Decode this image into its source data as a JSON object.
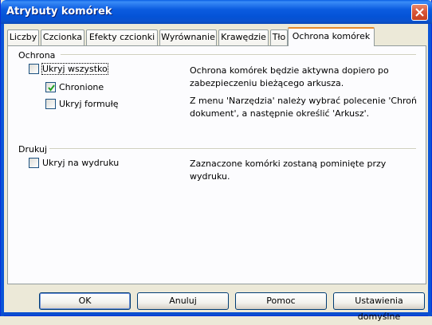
{
  "window": {
    "title": "Atrybuty komórek"
  },
  "tabs": [
    {
      "label": "Liczby"
    },
    {
      "label": "Czcionka"
    },
    {
      "label": "Efekty czcionki"
    },
    {
      "label": "Wyrównanie"
    },
    {
      "label": "Krawędzie"
    },
    {
      "label": "Tło"
    },
    {
      "label": "Ochrona komórek",
      "active": true
    }
  ],
  "protection": {
    "heading": "Ochrona",
    "hide_all": {
      "label": "Ukryj wszystko",
      "checked": false
    },
    "protected": {
      "label": "Chronione",
      "checked": true
    },
    "hide_formula": {
      "label": "Ukryj formułę",
      "checked": false
    },
    "desc1": "Ochrona komórek będzie aktywna dopiero po zabezpieczeniu bieżącego arkusza.",
    "desc2": "Z menu 'Narzędzia' należy wybrać polecenie 'Chroń dokument', a następnie określić 'Arkusz'."
  },
  "print": {
    "heading": "Drukuj",
    "hide_print": {
      "label": "Ukryj na wydruku",
      "checked": false
    },
    "desc": "Zaznaczone komórki zostaną pominięte przy wydruku."
  },
  "buttons": {
    "ok": "OK",
    "cancel": "Anuluj",
    "help": "Pomoc",
    "reset": "Ustawienia domyślne"
  },
  "colors": {
    "titlebar": "#0a5fe4",
    "active_tab_accent": "#e68b2c",
    "check": "#21a121"
  }
}
